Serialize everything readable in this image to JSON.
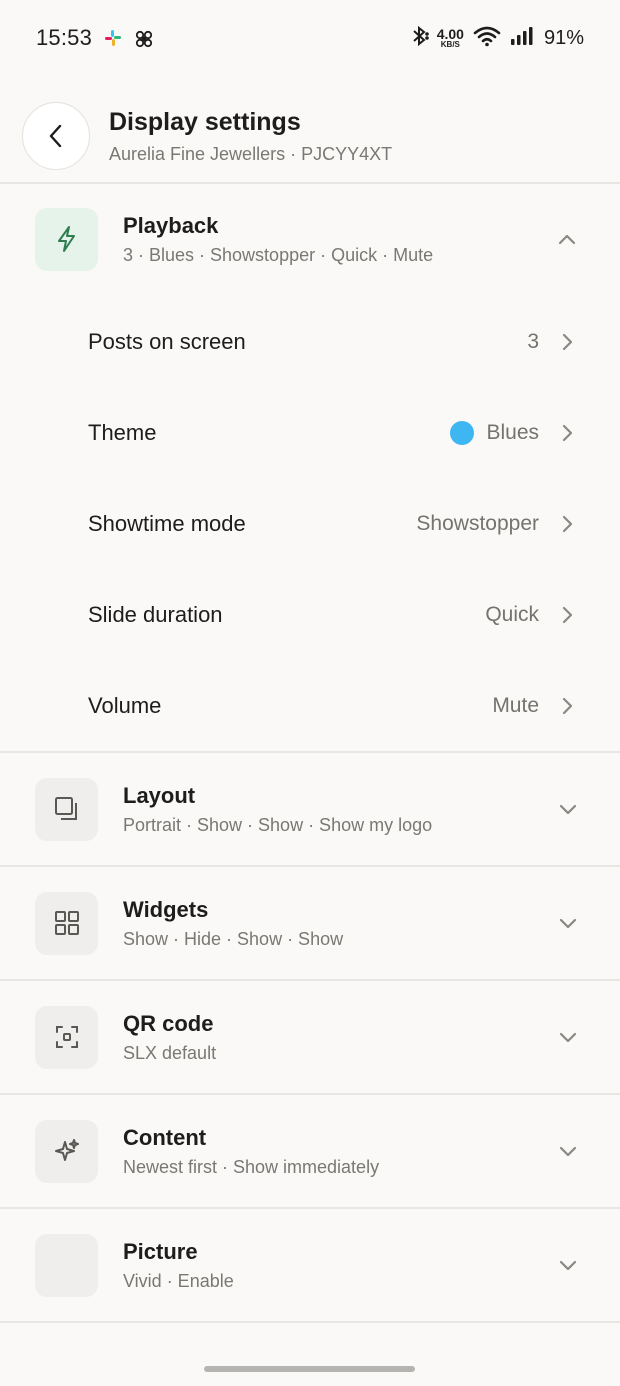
{
  "status_bar": {
    "time": "15:53",
    "net_speed_value": "4.00",
    "net_speed_unit": "KB/S",
    "battery": "91%"
  },
  "header": {
    "title": "Display settings",
    "subtitle": "Aurelia Fine Jewellers · PJCYY4XT"
  },
  "playback": {
    "title": "Playback",
    "summary": "3 · Blues · Showstopper · Quick · Mute",
    "rows": [
      {
        "label": "Posts on screen",
        "value": "3"
      },
      {
        "label": "Theme",
        "value": "Blues",
        "color": "#3db6f2"
      },
      {
        "label": "Showtime mode",
        "value": "Showstopper"
      },
      {
        "label": "Slide duration",
        "value": "Quick"
      },
      {
        "label": "Volume",
        "value": "Mute"
      }
    ]
  },
  "sections": [
    {
      "title": "Layout",
      "summary": "Portrait · Show · Show · Show my logo",
      "icon": "layout-icon"
    },
    {
      "title": "Widgets",
      "summary": "Show · Hide · Show · Show",
      "icon": "widgets-grid-icon"
    },
    {
      "title": "QR code",
      "summary": "SLX default",
      "icon": "qr-scan-icon"
    },
    {
      "title": "Content",
      "summary": "Newest first · Show immediately",
      "icon": "sparkle-icon"
    },
    {
      "title": "Picture",
      "summary": "Vivid · Enable",
      "icon": "picture-icon"
    }
  ],
  "colors": {
    "accent_green": "#2e7d4f",
    "active_icon_bg": "#e5f3ea",
    "theme_blue": "#3db6f2"
  }
}
